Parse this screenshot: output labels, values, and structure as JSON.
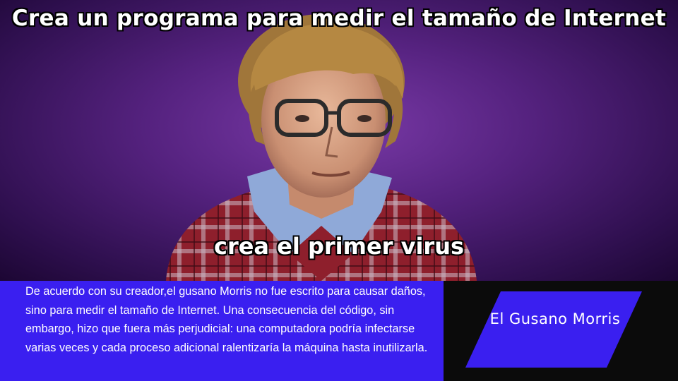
{
  "meme": {
    "top_caption": "Crea un programa para medir el tamaño de Internet",
    "bottom_caption": "crea el primer virus"
  },
  "info": {
    "text": "De acuerdo con su creador,el gusano Morris no fue escrito para causar daños, sino para medir el tamaño de Internet. Una consecuencia del código, sin embargo, hizo que fuera más perjudicial: una computadora podría infectarse varias veces y cada proceso adicional ralentizaría la máquina hasta inutilizarla."
  },
  "title_card": {
    "title": "El Gusano Morris"
  },
  "colors": {
    "panel_blue": "#3a1ff0",
    "panel_dark": "#0b0b0b",
    "backdrop_purple": "#55227f"
  }
}
